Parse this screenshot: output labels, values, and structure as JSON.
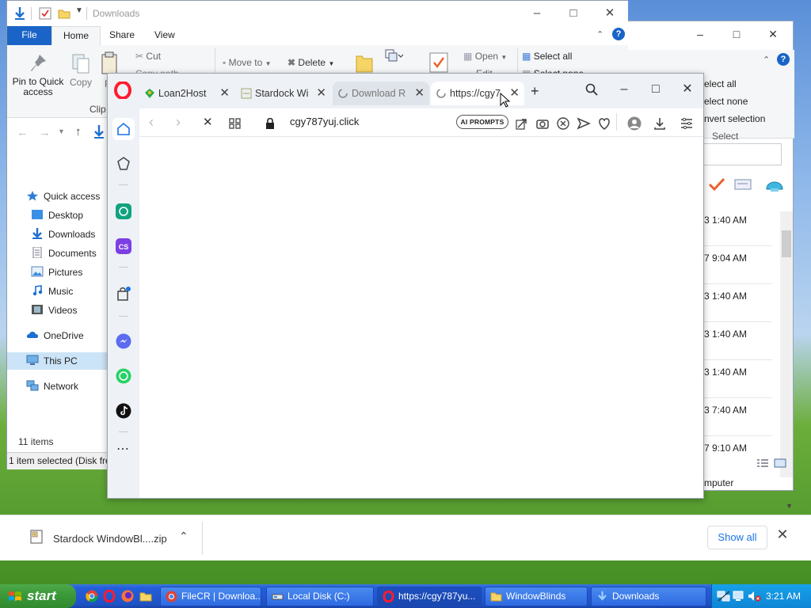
{
  "back_explorer": {
    "ribbon": [
      "Select all",
      "Select none",
      "Invert selection",
      "Select"
    ],
    "ribbon_shown": [
      "elect all",
      "elect none",
      "nvert selection",
      "Select"
    ],
    "times": [
      "3 1:40 AM",
      "7 9:04 AM",
      "3 1:40 AM",
      "3 1:40 AM",
      "3 1:40 AM",
      "3 7:40 AM",
      "7 9:10 AM"
    ],
    "status": "mputer"
  },
  "downloads_explorer": {
    "title": "Downloads",
    "tabs": {
      "file": "File",
      "home": "Home",
      "share": "Share",
      "view": "View"
    },
    "ribbon": {
      "pin": "Pin to Quick access",
      "copy": "Copy",
      "paste_partial": "P",
      "cut": "Cut",
      "copy_path": "Copy path",
      "clipboard": "Clip",
      "move_to": "Move to",
      "delete": "Delete",
      "open": "Open",
      "edit": "Edit",
      "select_all": "Select all",
      "select_none": "Select none"
    },
    "nav": [
      "Quick access",
      "Desktop",
      "Downloads",
      "Documents",
      "Pictures",
      "Music",
      "Videos",
      "OneDrive",
      "This PC",
      "Network"
    ],
    "item_count": "11 items",
    "status": "1 item selected (Disk free"
  },
  "browser": {
    "tabs": [
      {
        "label": "Loan2Host"
      },
      {
        "label": "Stardock Wi"
      },
      {
        "label": "Download R"
      },
      {
        "label": "https://cgy7"
      }
    ],
    "url": "cgy787yuj.click",
    "ai_prompts": "AI PROMPTS"
  },
  "download_bar": {
    "filename": "Stardock WindowBl....zip",
    "show_all": "Show all"
  },
  "taskbar": {
    "start": "start",
    "buttons": [
      "FileCR | Downloa...",
      "Local Disk (C:)",
      "https://cgy787yu...",
      "WindowBlinds",
      "Downloads"
    ],
    "clock": "3:21 AM"
  },
  "colors": {
    "opera_red": "#ff1b2d",
    "win_blue": "#1a64c8",
    "taskbar": "#245edb",
    "start_green": "#3c9a3a"
  }
}
